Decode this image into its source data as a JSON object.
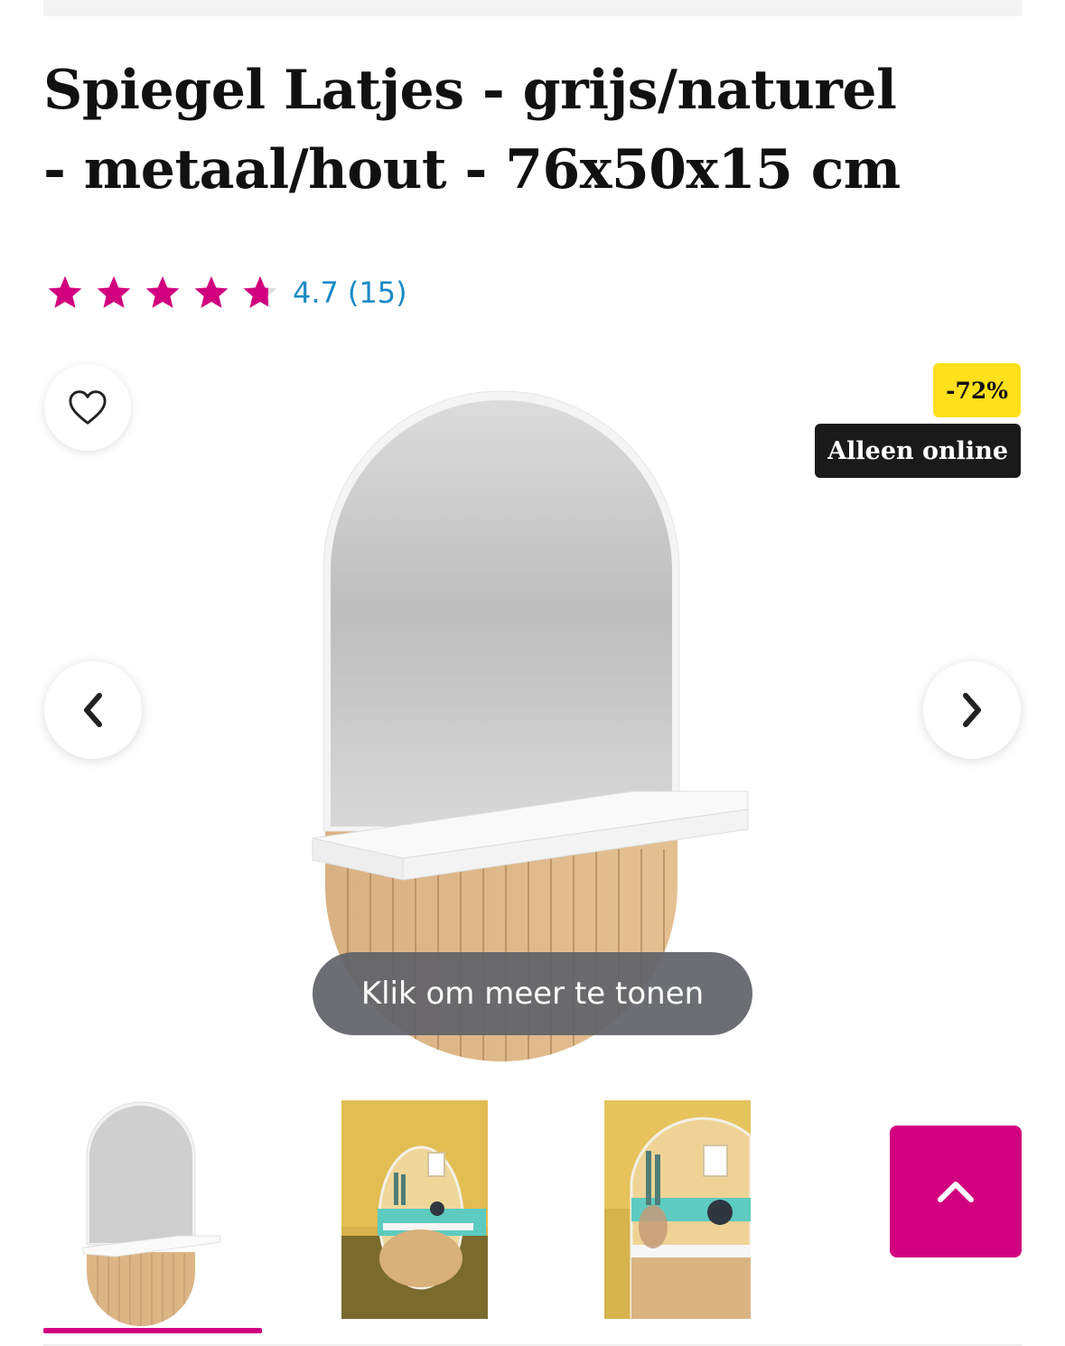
{
  "product": {
    "title_line1": "Spiegel Latjes - grijs/naturel",
    "title_line2": "- metaal/hout - 76x50x15 cm"
  },
  "rating": {
    "score": "4.7",
    "count": "(15)",
    "stars_value": 4.7,
    "stars_max": 5,
    "star_color": "#d1007f"
  },
  "badges": {
    "discount": "-72%",
    "online": "Alleen online"
  },
  "gallery": {
    "more_label": "Klik om meer te tonen",
    "selected_index": 0,
    "thumb_count": 3
  },
  "icons": {
    "favorite": "heart-outline-icon",
    "prev": "chevron-left-icon",
    "next": "chevron-right-icon",
    "scroll_top": "chevron-up-icon"
  },
  "colors": {
    "accent": "#d1007f",
    "discount_badge": "#ffe01b",
    "online_badge": "#1a1a1a",
    "rating_text": "#1a8ac6"
  }
}
